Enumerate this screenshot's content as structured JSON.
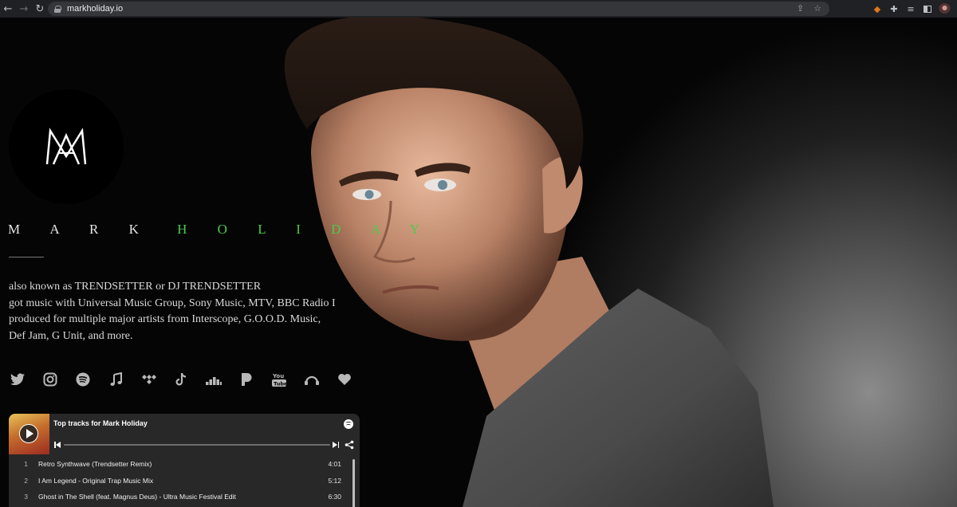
{
  "browser": {
    "url": "markholiday.io",
    "back_icon": "arrow-left-icon",
    "forward_icon": "arrow-right-icon",
    "reload_icon": "reload-icon"
  },
  "profile": {
    "logo_text": "MA",
    "first_name": "M A R K",
    "last_name": "H O L I D A Y",
    "accent_color": "#4ccb4c",
    "bio": [
      "also known as TRENDSETTER or DJ TRENDSETTER",
      "got music with Universal Music Group, Sony Music, MTV, BBC Radio I",
      "produced for multiple major artists from Interscope, G.O.O.D. Music,",
      "Def Jam, G Unit, and more."
    ]
  },
  "socials": [
    "twitter-icon",
    "instagram-icon",
    "spotify-icon",
    "apple-music-icon",
    "tidal-icon",
    "tiktok-icon",
    "deezer-icon",
    "pandora-icon",
    "youtube-icon",
    "audiomack-icon",
    "heart-icon"
  ],
  "player": {
    "title": "Top tracks for Mark Holiday",
    "progress": 0,
    "tracks": [
      {
        "num": "1",
        "name": "Retro Synthwave (Trendsetter Remix)",
        "duration": "4:01"
      },
      {
        "num": "2",
        "name": "I Am Legend - Original Trap Music Mix",
        "duration": "5:12"
      },
      {
        "num": "3",
        "name": "Ghost in The Shell (feat. Magnus Deus) - Ultra Music Festival Edit",
        "duration": "6:30"
      }
    ]
  }
}
